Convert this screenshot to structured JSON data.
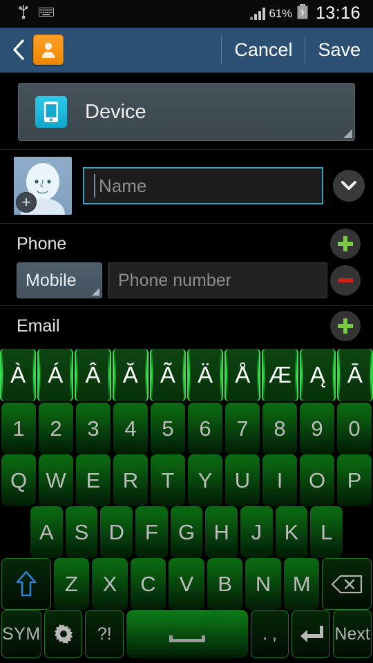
{
  "statusbar": {
    "usb_icon": "usb-icon",
    "keyboard_icon": "keyboard-icon",
    "signal_icon": "signal-bars-icon",
    "battery_percent": "61%",
    "battery_icon": "battery-charging-icon",
    "clock": "13:16"
  },
  "actionbar": {
    "back_icon": "back-chevron-icon",
    "app_icon": "contact-person-icon",
    "cancel_label": "Cancel",
    "save_label": "Save"
  },
  "account": {
    "icon": "device-phone-icon",
    "label": "Device"
  },
  "name_row": {
    "avatar_icon": "contact-photo-placeholder",
    "add_photo_badge": "+",
    "name_placeholder": "Name",
    "name_value": "",
    "expand_icon": "chevron-down-icon"
  },
  "phone_section": {
    "title": "Phone",
    "add_label": "+",
    "remove_label": "−",
    "type_value": "Mobile",
    "number_placeholder": "Phone number",
    "number_value": ""
  },
  "email_section": {
    "title": "Email",
    "add_label": "+"
  },
  "keyboard": {
    "accent_row": [
      "À",
      "Á",
      "Â",
      "Ă",
      "Ã",
      "Ä",
      "Å",
      "Æ",
      "Ą",
      "Ā"
    ],
    "number_row": [
      "1",
      "2",
      "3",
      "4",
      "5",
      "6",
      "7",
      "8",
      "9",
      "0"
    ],
    "row1": [
      "Q",
      "W",
      "E",
      "R",
      "T",
      "Y",
      "U",
      "I",
      "O",
      "P"
    ],
    "row2": [
      "A",
      "S",
      "D",
      "F",
      "G",
      "H",
      "J",
      "K",
      "L"
    ],
    "row3": {
      "shift_icon": "shift-arrow-icon",
      "letters": [
        "Z",
        "X",
        "C",
        "V",
        "B",
        "N",
        "M"
      ],
      "backspace_icon": "backspace-icon"
    },
    "row4": {
      "sym_label": "SYM",
      "settings_icon": "gear-icon",
      "punct_label": "?!",
      "space_icon": "spacebar-icon",
      "comma_label": ". ,",
      "enter_icon": "enter-arrow-icon",
      "next_label": "Next"
    }
  },
  "colors": {
    "actionbar": "#2b5074",
    "accent_cyan": "#19b5d8",
    "focus_border": "#39a3c4",
    "plus_green": "#7ac943",
    "minus_red": "#cc2218",
    "key_green": "#0a6312",
    "app_orange": "#f08700"
  }
}
